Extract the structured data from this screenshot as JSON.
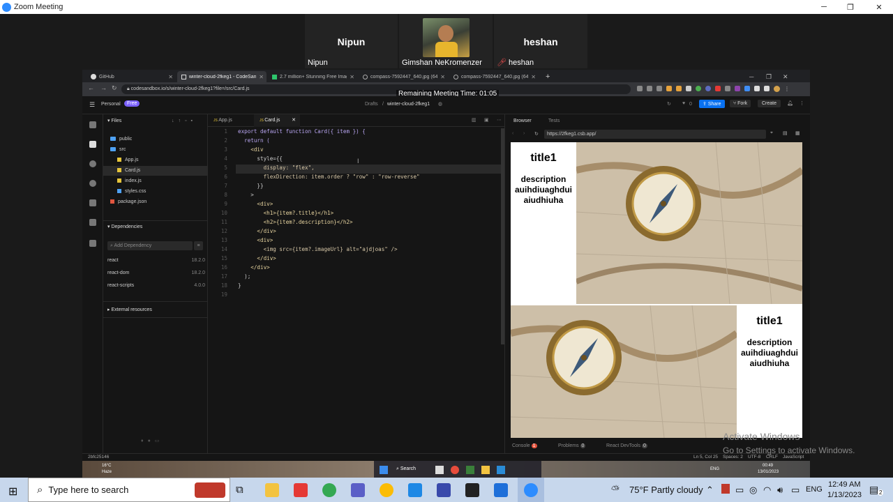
{
  "zoom": {
    "title": "Zoom Meeting",
    "participants": [
      {
        "big": "Nipun",
        "label": "Nipun"
      },
      {
        "big": "",
        "label": "Gimshan NeKromenzer"
      },
      {
        "big": "heshan",
        "label": "heshan"
      }
    ],
    "timer": "Remaining Meeting Time: 01:05"
  },
  "browser": {
    "tabs": [
      {
        "label": "GitHub"
      },
      {
        "label": "winter-cloud-2fkeg1 - CodeSandbox"
      },
      {
        "label": "2.7 million+ Stunning Free Imag..."
      },
      {
        "label": "compass-7592447_640.jpg (640..."
      },
      {
        "label": "compass-7592447_640.jpg (640..."
      }
    ],
    "url": "codesandbox.io/s/winter-cloud-2fkeg1?file=/src/Card.js"
  },
  "csb": {
    "workspace": "Personal",
    "plan": "Free",
    "breadcrumb_folder": "Drafts",
    "breadcrumb_sep": "/",
    "sandbox_name": "winter-cloud-2fkeg1",
    "likes": "0",
    "share": "Share",
    "fork": "Fork",
    "create": "Create"
  },
  "sidebar": {
    "files_title": "Files",
    "tree": [
      {
        "name": "public",
        "type": "folder"
      },
      {
        "name": "src",
        "type": "folder"
      },
      {
        "name": "App.js",
        "type": "js"
      },
      {
        "name": "Card.js",
        "type": "js",
        "selected": true
      },
      {
        "name": "index.js",
        "type": "js"
      },
      {
        "name": "styles.css",
        "type": "css"
      },
      {
        "name": "package.json",
        "type": "json"
      }
    ],
    "deps_title": "Dependencies",
    "dep_placeholder": "Add Dependency",
    "deps": [
      {
        "name": "react",
        "version": "18.2.0"
      },
      {
        "name": "react-dom",
        "version": "18.2.0"
      },
      {
        "name": "react-scripts",
        "version": "4.0.0"
      }
    ],
    "external": "External resources"
  },
  "editor": {
    "tabs": [
      "App.js",
      "Card.js"
    ],
    "lines": [
      {
        "n": "1",
        "text": "export default function Card({ item }) {"
      },
      {
        "n": "2",
        "text": "  return ("
      },
      {
        "n": "3",
        "text": "    <div"
      },
      {
        "n": "4",
        "text": "      style={{"
      },
      {
        "n": "5",
        "text": "        display: \"flex\","
      },
      {
        "n": "6",
        "text": "        flexDirection: item.order ? \"row\" : \"row-reverse\""
      },
      {
        "n": "7",
        "text": "      }}"
      },
      {
        "n": "8",
        "text": "    >"
      },
      {
        "n": "9",
        "text": "      <div>"
      },
      {
        "n": "10",
        "text": "        <h1>{item?.title}</h1>"
      },
      {
        "n": "11",
        "text": "        <h2>{item?.description}</h2>"
      },
      {
        "n": "12",
        "text": "      </div>"
      },
      {
        "n": "13",
        "text": "      <div>"
      },
      {
        "n": "14",
        "text": "        <img src={item?.imageUrl} alt=\"ajdjoas\" />"
      },
      {
        "n": "15",
        "text": "      </div>"
      },
      {
        "n": "16",
        "text": "    </div>"
      },
      {
        "n": "17",
        "text": "  );"
      },
      {
        "n": "18",
        "text": "}"
      },
      {
        "n": "19",
        "text": ""
      }
    ]
  },
  "preview": {
    "tab_browser": "Browser",
    "tab_tests": "Tests",
    "url": "https://2fkeg1.csb.app/",
    "cards": [
      {
        "title": "title1",
        "description": "description auihdiuaghdui aiudhiuha"
      },
      {
        "title": "title1",
        "description": "description auihdiuaghdui aiudhiuha"
      }
    ],
    "console": "Console",
    "console_count": "1",
    "problems": "Problems",
    "problems_count": "0",
    "devtools": "React DevTools",
    "devtools_count": "0"
  },
  "status": {
    "hash": "2bfc25146",
    "position": "Ln 5, Col 25",
    "spaces": "Spaces: 2",
    "encoding": "UTF-8",
    "eol": "CRLF",
    "language": "JavaScript"
  },
  "inner_taskbar": {
    "weather_temp": "16°C",
    "weather_desc": "Haze",
    "search": "Search",
    "time": "00:49",
    "date": "13/01/2023",
    "lang": "ENG"
  },
  "watermark": {
    "line1": "Activate Windows",
    "line2": "Go to Settings to activate Windows."
  },
  "taskbar": {
    "search_placeholder": "Type here to search",
    "weather": "75°F  Partly cloudy",
    "lang": "ENG",
    "time": "12:49 AM",
    "date": "1/13/2023",
    "notif_count": "2"
  }
}
